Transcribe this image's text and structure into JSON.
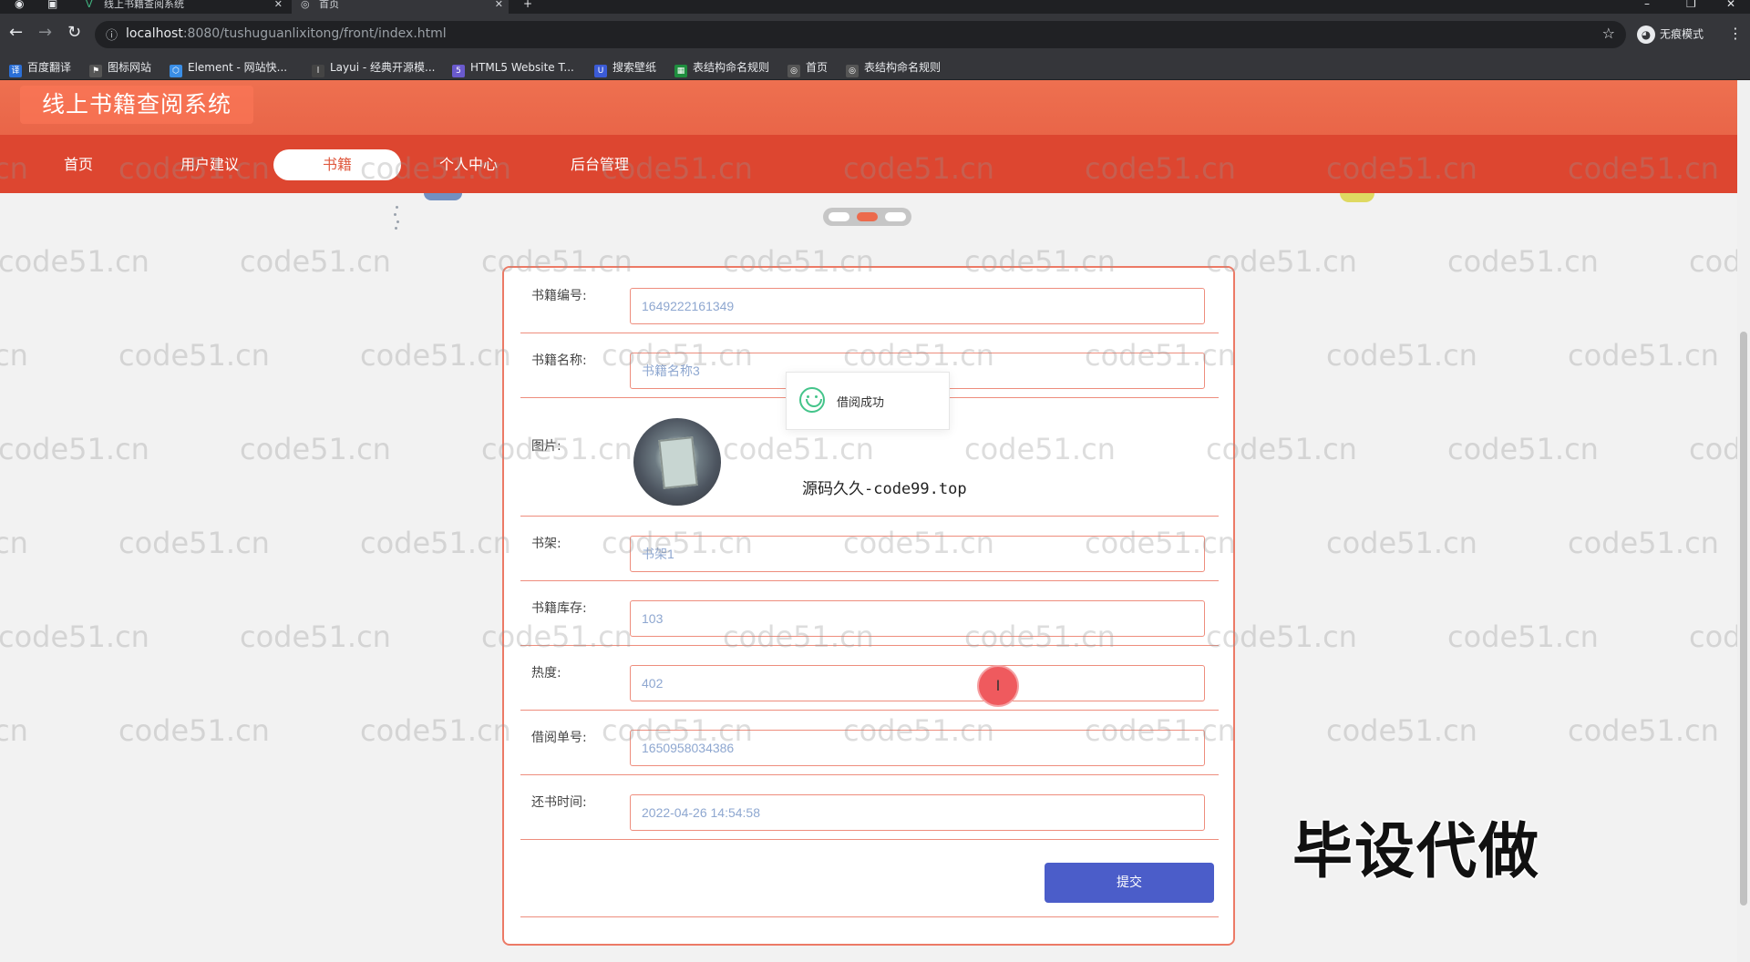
{
  "browser": {
    "tabs": [
      {
        "label": "线上书籍查阅系统",
        "active": false
      },
      {
        "label": "首页",
        "active": true
      }
    ],
    "new_tab": "+",
    "url_host": "localhost",
    "url_rest": ":8080/tushuguanlixitong/front/index.html",
    "incognito_label": "无痕模式",
    "bookmarks": [
      "百度翻译",
      "图标网站",
      "Element - 网站快...",
      "Layui - 经典开源模...",
      "HTML5 Website T...",
      "搜索壁纸",
      "表结构命名规则",
      "首页",
      "表结构命名规则"
    ]
  },
  "site": {
    "title": "线上书籍查阅系统",
    "nav": [
      {
        "label": "首页",
        "active": false
      },
      {
        "label": "用户建议",
        "active": false
      },
      {
        "label": "书籍",
        "active": true
      },
      {
        "label": "个人中心",
        "active": false
      },
      {
        "label": "后台管理",
        "active": false
      }
    ]
  },
  "form": {
    "book_no_label": "书籍编号:",
    "book_no_value": "1649222161349",
    "book_name_label": "书籍名称:",
    "book_name_value": "书籍名称3",
    "image_label": "图片:",
    "shelf_label": "书架:",
    "shelf_value": "书架1",
    "stock_label": "书籍库存:",
    "stock_value": "103",
    "heat_label": "热度:",
    "heat_value": "402",
    "borrow_no_label": "借阅单号:",
    "borrow_no_value": "1650958034386",
    "return_time_label": "还书时间:",
    "return_time_value": "2022-04-26 14:54:58",
    "submit_label": "提交"
  },
  "toast": {
    "message": "借阅成功"
  },
  "overlay": {
    "source_text": "源码久久-code99.top",
    "promo_text": "毕设代做",
    "watermark": "code51.cn",
    "cursor_glyph": "I"
  },
  "colors": {
    "header": "#ee7050",
    "navbar": "#dd4630",
    "card_border": "#ec7a66",
    "submit": "#4b5dc9",
    "toast_icon": "#44c48a"
  }
}
